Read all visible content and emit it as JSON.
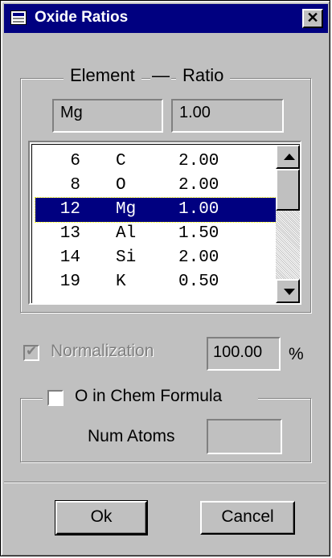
{
  "window": {
    "title": "Oxide Ratios",
    "close_glyph": "✕"
  },
  "group_top": {
    "legend_element": "Element",
    "legend_dash": "—",
    "legend_ratio": "Ratio"
  },
  "element_field": {
    "value": "Mg"
  },
  "ratio_field": {
    "value": "1.00"
  },
  "list": {
    "rows": [
      {
        "num": "6",
        "symbol": "C",
        "ratio": "2.00",
        "selected": false
      },
      {
        "num": "8",
        "symbol": "O",
        "ratio": "2.00",
        "selected": false
      },
      {
        "num": "12",
        "symbol": "Mg",
        "ratio": "1.00",
        "selected": true
      },
      {
        "num": "13",
        "symbol": "Al",
        "ratio": "1.50",
        "selected": false
      },
      {
        "num": "14",
        "symbol": "Si",
        "ratio": "2.00",
        "selected": false
      },
      {
        "num": "19",
        "symbol": "K",
        "ratio": "0.50",
        "selected": false
      }
    ]
  },
  "normalization": {
    "label": "Normalization",
    "checked": true,
    "enabled": false,
    "value": "100.00",
    "unit": "%"
  },
  "group_bottom": {
    "checkbox_label": "O in Chem Formula",
    "checked": false,
    "num_atoms_label": "Num Atoms",
    "num_atoms_value": ""
  },
  "buttons": {
    "ok": "Ok",
    "cancel": "Cancel"
  },
  "icons": {
    "title": "window-icon",
    "check": "checkmark-icon"
  }
}
